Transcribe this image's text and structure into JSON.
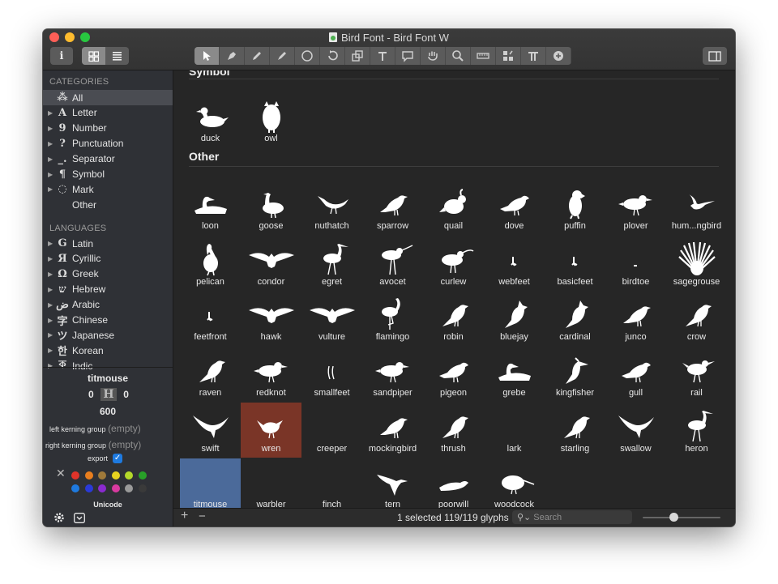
{
  "window": {
    "title": "Bird Font - Bird Font W",
    "traffic_colors": [
      "#fe5f57",
      "#febc2e",
      "#28c840"
    ]
  },
  "toolbar": {
    "info_label": "i",
    "tool_icons": [
      "arrow-cursor-icon",
      "pen-icon",
      "pencil-icon",
      "brush-icon",
      "circle-icon",
      "rotate-icon",
      "resize-icon",
      "text-icon",
      "speech-bubble-icon",
      "hand-icon",
      "magnifier-icon",
      "ruler-icon",
      "spacing-icon",
      "kerning-icon",
      "add-icon"
    ],
    "selected_tool": 0
  },
  "sidebar": {
    "categories_heading": "CATEGORIES",
    "categories": [
      {
        "glyph": "⁂",
        "label": "All",
        "arrow": false,
        "selected": true
      },
      {
        "glyph": "A",
        "label": "Letter",
        "arrow": true
      },
      {
        "glyph": "9",
        "label": "Number",
        "arrow": true
      },
      {
        "glyph": "?",
        "label": "Punctuation",
        "arrow": true
      },
      {
        "glyph": "_.",
        "label": "Separator",
        "arrow": true
      },
      {
        "glyph": "¶",
        "label": "Symbol",
        "arrow": true
      },
      {
        "glyph": "◌",
        "label": "Mark",
        "arrow": true
      },
      {
        "glyph": "",
        "label": "Other",
        "arrow": false
      }
    ],
    "languages_heading": "LANGUAGES",
    "languages": [
      {
        "glyph": "G",
        "label": "Latin"
      },
      {
        "glyph": "Я",
        "label": "Cyrillic"
      },
      {
        "glyph": "Ω",
        "label": "Greek"
      },
      {
        "glyph": "ש",
        "label": "Hebrew"
      },
      {
        "glyph": "ض",
        "label": "Arabic"
      },
      {
        "glyph": "字",
        "label": "Chinese"
      },
      {
        "glyph": "ツ",
        "label": "Japanese"
      },
      {
        "glyph": "한",
        "label": "Korean"
      },
      {
        "glyph": "ক",
        "label": "Indic"
      }
    ]
  },
  "glyph_info": {
    "name": "titmouse",
    "left_bearing": "0",
    "glyph_letter": "H",
    "right_bearing": "0",
    "width": "600",
    "left_kerning_label": "left kerning group",
    "left_kerning_value": "(empty)",
    "right_kerning_label": "right kerning group",
    "right_kerning_value": "(empty)",
    "export_label": "export",
    "export_checked": true,
    "colors": [
      "#e0332a",
      "#e87e1e",
      "#a07a3a",
      "#e8d21f",
      "#b4d82a",
      "#28a028",
      "#1e7ae0",
      "#2a3ad8",
      "#8a2ad0",
      "#d83aa0",
      "#9a9a9a",
      "#3a3a3a"
    ],
    "unicode_label": "Unicode"
  },
  "main": {
    "section_symbol": "Symbol",
    "section_other": "Other",
    "symbol_glyphs": [
      {
        "name": "duck",
        "shape": "duck"
      },
      {
        "name": "owl",
        "shape": "owl"
      }
    ],
    "other_glyphs": [
      {
        "name": "loon",
        "shape": "swimmer"
      },
      {
        "name": "goose",
        "shape": "goose"
      },
      {
        "name": "nuthatch",
        "shape": "nuthatch"
      },
      {
        "name": "sparrow",
        "shape": "song"
      },
      {
        "name": "quail",
        "shape": "quail"
      },
      {
        "name": "dove",
        "shape": "dove"
      },
      {
        "name": "puffin",
        "shape": "puffin"
      },
      {
        "name": "plover",
        "shape": "plover"
      },
      {
        "name": "hum...ngbird",
        "shape": "hummer"
      },
      {
        "name": "pelican",
        "shape": "pelican"
      },
      {
        "name": "condor",
        "shape": "spread"
      },
      {
        "name": "egret",
        "shape": "wader"
      },
      {
        "name": "avocet",
        "shape": "avocet"
      },
      {
        "name": "curlew",
        "shape": "curlew"
      },
      {
        "name": "webfeet",
        "shape": "foot"
      },
      {
        "name": "basicfeet",
        "shape": "foot"
      },
      {
        "name": "birdtoe",
        "shape": "dot"
      },
      {
        "name": "sagegrouse",
        "shape": "grouse"
      },
      {
        "name": "feetfront",
        "shape": "foot"
      },
      {
        "name": "hawk",
        "shape": "spread"
      },
      {
        "name": "vulture",
        "shape": "spread"
      },
      {
        "name": "flamingo",
        "shape": "flamingo"
      },
      {
        "name": "robin",
        "shape": "perch"
      },
      {
        "name": "bluejay",
        "shape": "jay"
      },
      {
        "name": "cardinal",
        "shape": "jay"
      },
      {
        "name": "junco",
        "shape": "song"
      },
      {
        "name": "crow",
        "shape": "perch"
      },
      {
        "name": "raven",
        "shape": "perch"
      },
      {
        "name": "redknot",
        "shape": "plover"
      },
      {
        "name": "smallfeet",
        "shape": "smallfeet"
      },
      {
        "name": "sandpiper",
        "shape": "plover"
      },
      {
        "name": "pigeon",
        "shape": "dove"
      },
      {
        "name": "grebe",
        "shape": "swimmer"
      },
      {
        "name": "kingfisher",
        "shape": "kingfisher"
      },
      {
        "name": "gull",
        "shape": "dove"
      },
      {
        "name": "rail",
        "shape": "rail"
      },
      {
        "name": "swift",
        "shape": "swift"
      },
      {
        "name": "wren",
        "shape": "wren",
        "selected": "red"
      },
      {
        "name": "creeper",
        "shape": "none"
      },
      {
        "name": "mockingbird",
        "shape": "song"
      },
      {
        "name": "thrush",
        "shape": "perch"
      },
      {
        "name": "lark",
        "shape": "none"
      },
      {
        "name": "starling",
        "shape": "perch"
      },
      {
        "name": "swallow",
        "shape": "swift"
      },
      {
        "name": "heron",
        "shape": "wader"
      },
      {
        "name": "titmouse",
        "shape": "none",
        "selected": "blue"
      },
      {
        "name": "warbler",
        "shape": "none"
      },
      {
        "name": "finch",
        "shape": "none"
      },
      {
        "name": "tern",
        "shape": "tern"
      },
      {
        "name": "poorwill",
        "shape": "poorwill"
      },
      {
        "name": "woodcock",
        "shape": "woodcock"
      }
    ]
  },
  "statusbar": {
    "add_label": "+",
    "remove_label": "−",
    "status_text": "1 selected 119/119 glyphs",
    "search_placeholder": "Search",
    "zoom_level": 0.4
  }
}
